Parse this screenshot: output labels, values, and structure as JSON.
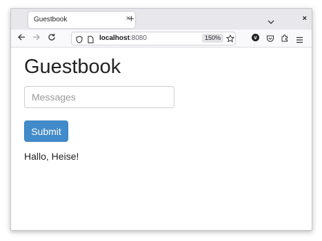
{
  "browser": {
    "tab_title": "Guestbook",
    "tab_close": "×",
    "new_tab": "+",
    "window_close": "×",
    "url_host": "localhost",
    "url_port": ":8080",
    "zoom": "150%",
    "extension_badge": "v"
  },
  "page": {
    "title": "Guestbook",
    "input_placeholder": "Messages",
    "submit_label": "Submit",
    "messages": [
      "Hallo, Heise!"
    ]
  },
  "colors": {
    "primary_button": "#428bca",
    "tab_bar": "#e8e7ec",
    "nav_bar": "#f9f9fb"
  }
}
